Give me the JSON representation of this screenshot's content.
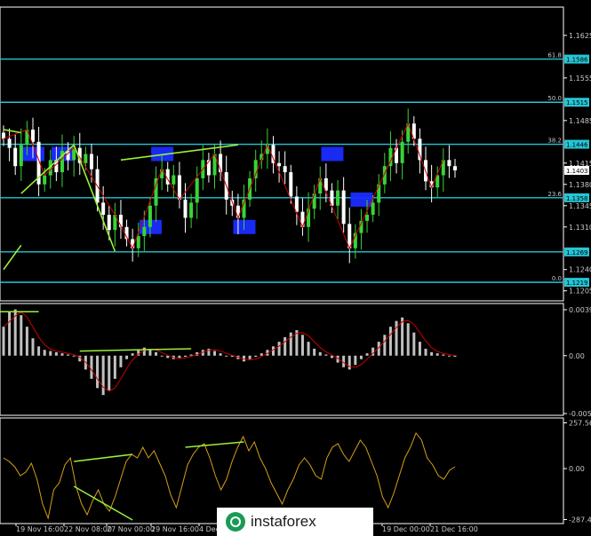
{
  "chart_data": {
    "type": "line",
    "instrument_view": "price candlesticks with indicator sub-windows",
    "price_panel": {
      "axis_ticks": [
        "1.1625",
        "1.1555",
        "1.1485",
        "1.1415",
        "1.1380",
        "1.1345",
        "1.1310",
        "1.1240",
        "1.1205"
      ],
      "axis_range": [
        1.119,
        1.167
      ],
      "current_price": "1.1403",
      "levels": [
        {
          "ratio": "61.8",
          "price": "1.1586",
          "value": 1.1586
        },
        {
          "ratio": "50.0",
          "price": "1.1515",
          "value": 1.1515
        },
        {
          "ratio": "38.2",
          "price": "1.1446",
          "value": 1.1446
        },
        {
          "ratio": "23.6",
          "price": "1.1358",
          "value": 1.1358
        },
        {
          "ratio": "",
          "price": "1.1269",
          "value": 1.1269
        },
        {
          "ratio": "0.0",
          "price": "1.1219",
          "value": 1.1219
        }
      ],
      "closes": [
        1.1455,
        1.144,
        1.141,
        1.1445,
        1.147,
        1.145,
        1.138,
        1.1395,
        1.142,
        1.14,
        1.1435,
        1.142,
        1.144,
        1.1415,
        1.143,
        1.1405,
        1.135,
        1.133,
        1.1305,
        1.133,
        1.131,
        1.129,
        1.1275,
        1.1295,
        1.131,
        1.1345,
        1.139,
        1.1405,
        1.138,
        1.1395,
        1.1355,
        1.1325,
        1.135,
        1.139,
        1.142,
        1.1395,
        1.143,
        1.14,
        1.1355,
        1.1345,
        1.1325,
        1.1355,
        1.139,
        1.142,
        1.143,
        1.1445,
        1.1415,
        1.141,
        1.14,
        1.136,
        1.1335,
        1.131,
        1.134,
        1.1365,
        1.139,
        1.137,
        1.1345,
        1.137,
        1.1315,
        1.1275,
        1.13,
        1.132,
        1.133,
        1.135,
        1.138,
        1.141,
        1.144,
        1.1415,
        1.145,
        1.148,
        1.1455,
        1.142,
        1.1385,
        1.1375,
        1.1395,
        1.142,
        1.141,
        1.1403
      ]
    },
    "osma_panel": {
      "axis_ticks": [
        "0.00397",
        "0.00",
        "-0.005"
      ],
      "axis_range": [
        -0.005,
        0.0042
      ],
      "bars": [
        0.0025,
        0.0038,
        0.004,
        0.0035,
        0.0025,
        0.0015,
        0.0008,
        0.0005,
        0.0004,
        0.0003,
        0.0002,
        0.0001,
        0.0,
        -0.0005,
        -0.0012,
        -0.002,
        -0.0028,
        -0.0034,
        -0.003,
        -0.002,
        -0.001,
        -0.0003,
        0.0002,
        0.0005,
        0.0007,
        0.0005,
        0.0003,
        0.0,
        -0.0002,
        -0.0003,
        -0.0002,
        -0.0001,
        0.0001,
        0.0003,
        0.0005,
        0.0006,
        0.0004,
        0.0002,
        0.0,
        -0.0001,
        -0.0003,
        -0.0005,
        -0.0003,
        -0.0001,
        0.0002,
        0.0005,
        0.0008,
        0.0012,
        0.0016,
        0.002,
        0.0022,
        0.0018,
        0.0012,
        0.0006,
        0.0003,
        0.0001,
        -0.0002,
        -0.0006,
        -0.001,
        -0.0012,
        -0.0008,
        -0.0003,
        0.0002,
        0.0007,
        0.0012,
        0.0018,
        0.0025,
        0.003,
        0.0033,
        0.0028,
        0.002,
        0.0012,
        0.0006,
        0.0003,
        0.0002,
        0.0001,
        0.0,
        -0.0001
      ]
    },
    "cci_panel": {
      "axis_ticks": [
        "257.5664",
        "0.00",
        "-287.4716"
      ],
      "axis_range": [
        -300,
        270
      ],
      "values": [
        60,
        40,
        10,
        -40,
        -20,
        30,
        -60,
        -200,
        -280,
        -120,
        -80,
        20,
        60,
        -100,
        -200,
        -260,
        -180,
        -120,
        -200,
        -240,
        -160,
        -60,
        40,
        80,
        60,
        120,
        60,
        100,
        30,
        -40,
        -150,
        -220,
        -100,
        20,
        80,
        120,
        140,
        60,
        -40,
        -120,
        -60,
        40,
        120,
        180,
        100,
        150,
        60,
        0,
        -80,
        -140,
        -200,
        -120,
        -60,
        20,
        60,
        20,
        -40,
        -60,
        60,
        120,
        140,
        80,
        40,
        100,
        160,
        120,
        40,
        -40,
        -160,
        -220,
        -140,
        -40,
        60,
        120,
        200,
        160,
        60,
        20,
        -40,
        -60,
        -10,
        10
      ]
    },
    "x_labels": [
      "19 Nov 16:00",
      "22 Nov 08:00",
      "27 Nov 00:00",
      "29 Nov 16:00",
      "4 Dec",
      "19 Dec 00:00",
      "21 Dec 16:00"
    ],
    "colors": {
      "background": "#000000",
      "bull_candle": "#38d438",
      "bear_candle": "#ffffff",
      "level_line": "#25c6d6",
      "zigzag": "#cc0000",
      "trendline": "#9aef3a",
      "zone_box": "#1a2cff",
      "osma_bar": "#c0c0c0",
      "signal": "#cc0000",
      "cci_line": "#d4a017"
    }
  },
  "watermark": {
    "brand": "instaforex"
  }
}
